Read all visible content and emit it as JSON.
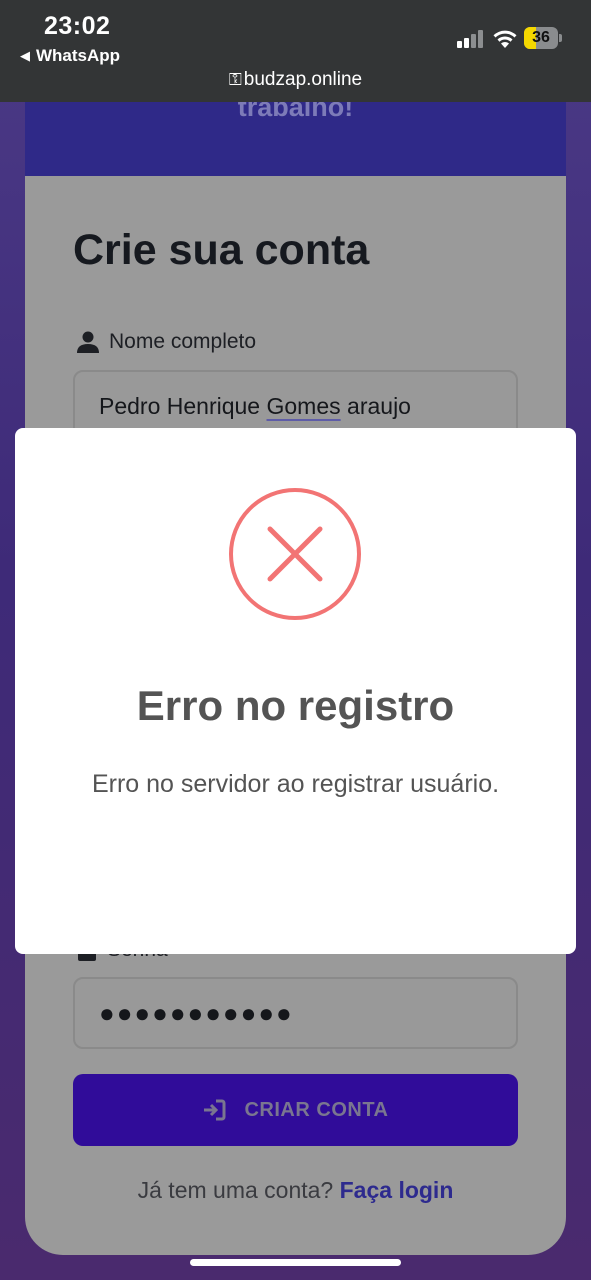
{
  "status_bar": {
    "time": "23:02",
    "back_app": "WhatsApp",
    "url": "budzap.online",
    "battery_level": "36",
    "battery_fraction": 0.36,
    "battery_color": "#f5d800",
    "signal_bars_active": 2,
    "signal_bars_total": 4
  },
  "page": {
    "header_text": "trabalho!",
    "title": "Crie sua conta",
    "name_label": "Nome completo",
    "name_value_parts": [
      "Pedro Henrique ",
      "Gomes",
      " araujo"
    ],
    "password_label": "Senha",
    "password_value": "●●●●●●●●●●●",
    "create_button": "CRIAR CONTA",
    "login_prompt": "Já tem uma conta?",
    "login_link": "Faça login",
    "accent_color": "#300c99"
  },
  "modal": {
    "title": "Erro no registro",
    "message": "Erro no servidor ao registrar usuário.",
    "icon": "error-x-icon",
    "icon_color": "#f27474"
  }
}
